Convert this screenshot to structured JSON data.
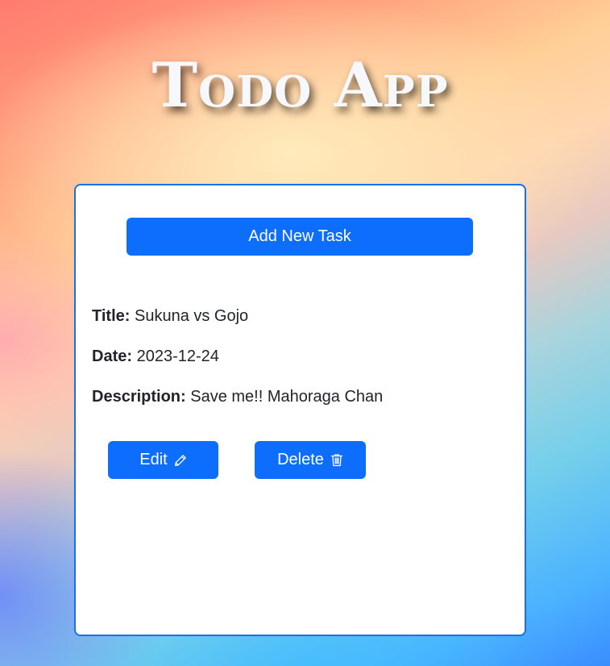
{
  "app": {
    "title": "Todo App"
  },
  "toolbar": {
    "add_label": "Add New Task"
  },
  "task": {
    "title_label": "Title:",
    "title_value": "Sukuna vs Gojo",
    "date_label": "Date:",
    "date_value": "2023-12-24",
    "description_label": "Description:",
    "description_value": "Save me!! Mahoraga Chan"
  },
  "actions": {
    "edit_label": "Edit",
    "edit_icon": "pencil-icon",
    "delete_label": "Delete",
    "delete_icon": "trash-icon"
  },
  "colors": {
    "primary": "#0d6efd",
    "card_border": "#1a6ff0"
  }
}
